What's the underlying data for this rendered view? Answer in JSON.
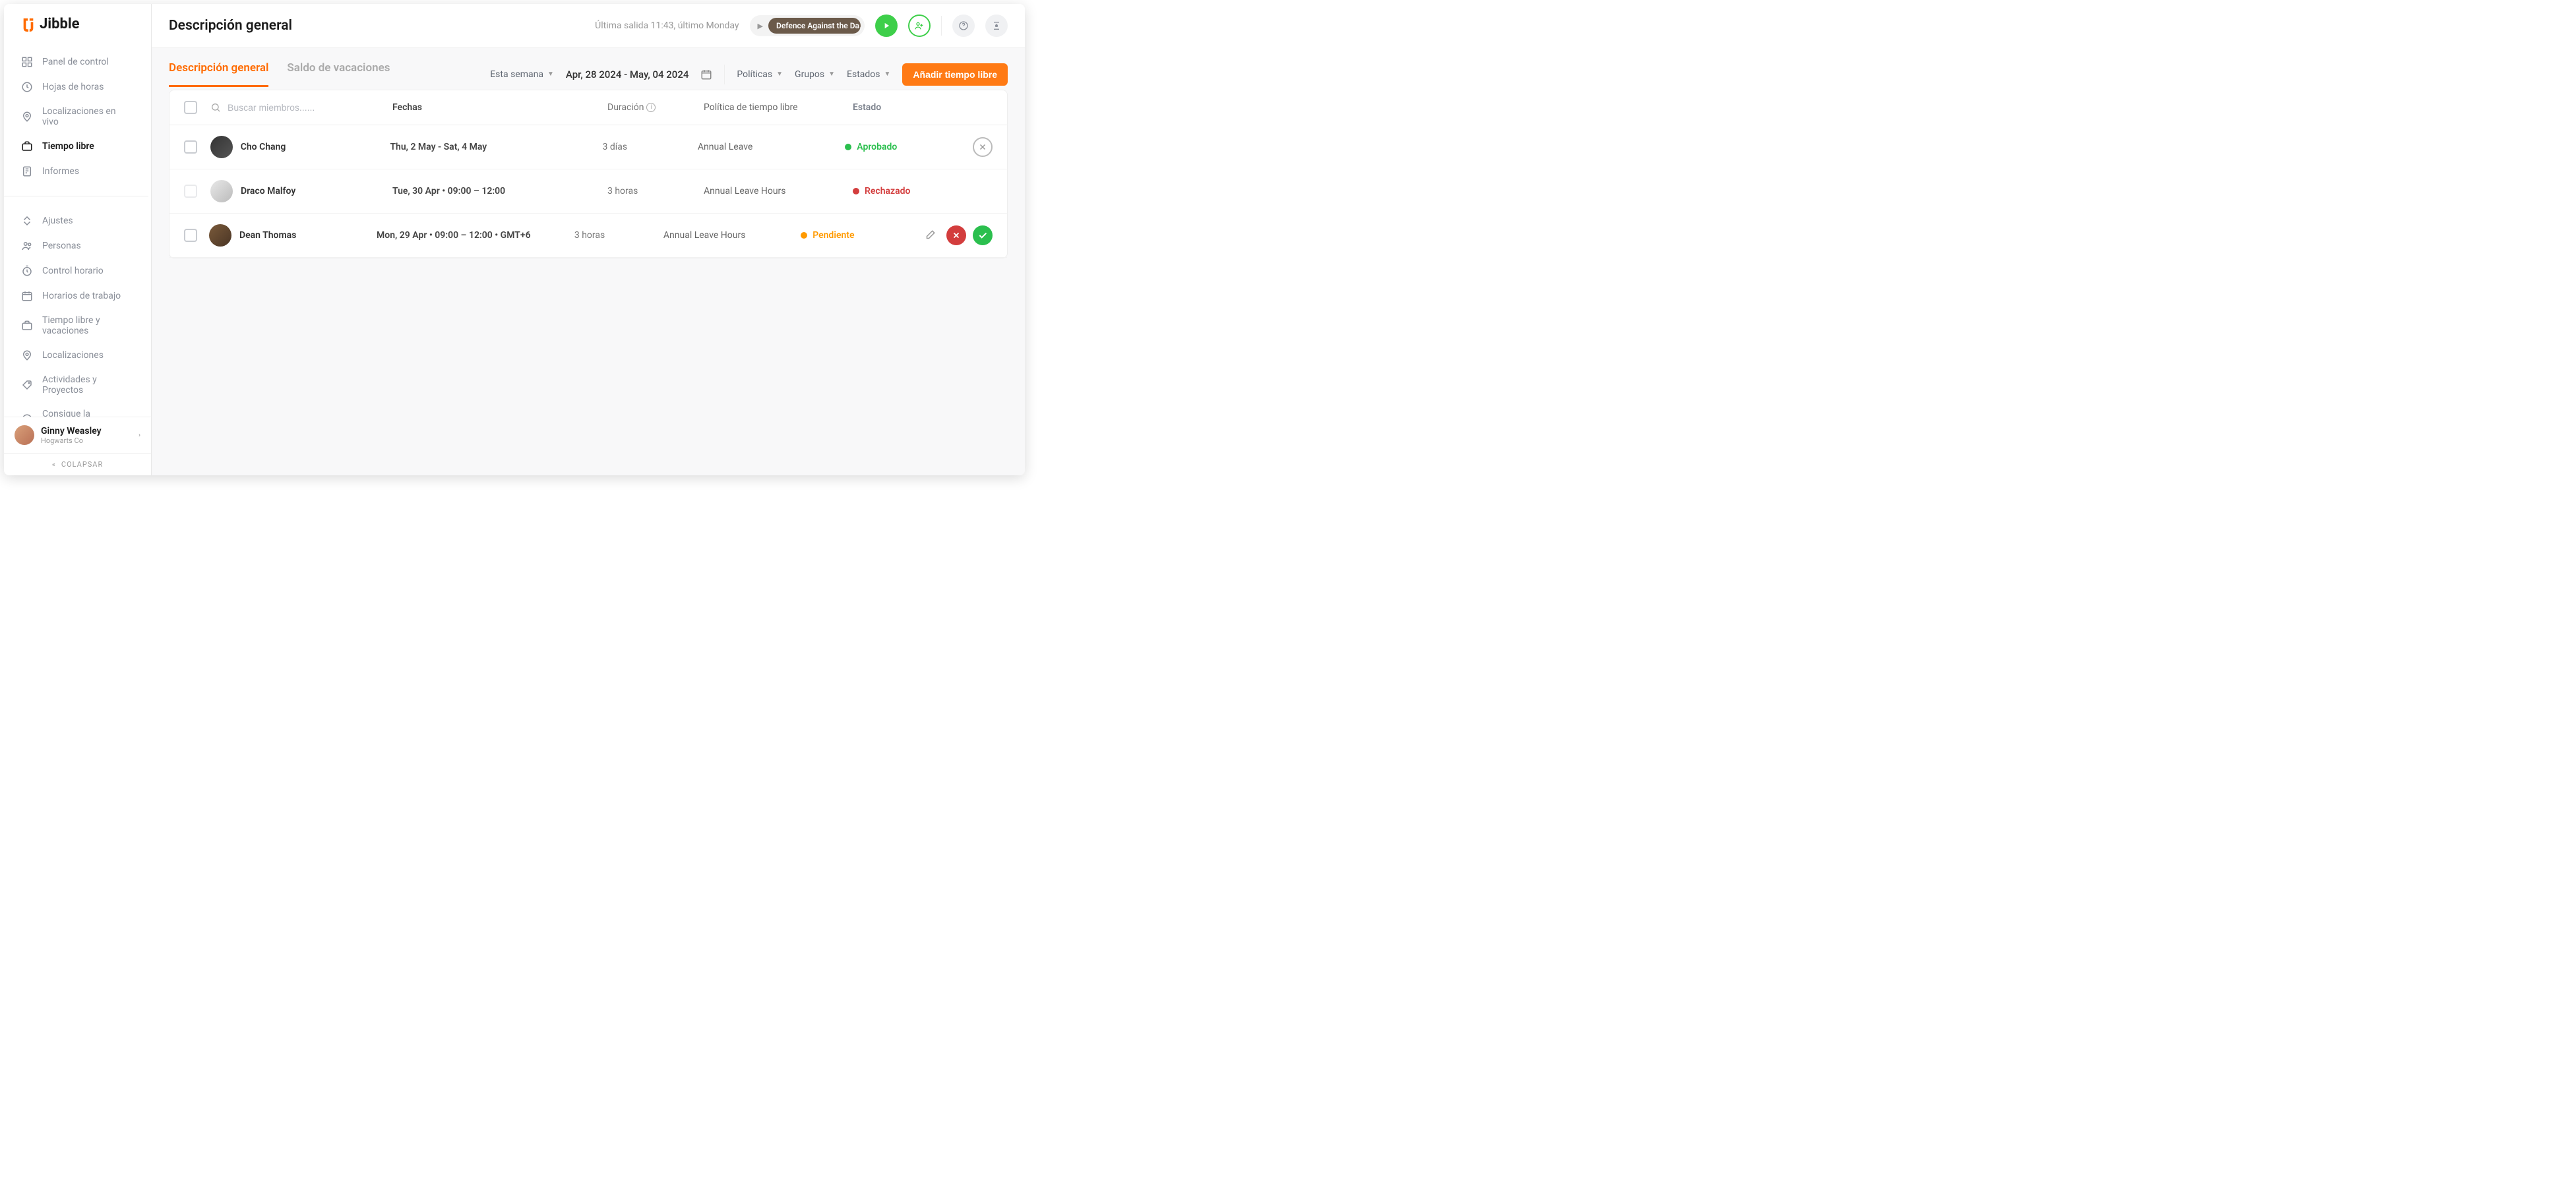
{
  "brand": "Jibble",
  "sidebar": {
    "nav_main": [
      {
        "label": "Panel de control",
        "icon": "dashboard-icon"
      },
      {
        "label": "Hojas de horas",
        "icon": "clock-icon"
      },
      {
        "label": "Localizaciones en vivo",
        "icon": "location-icon"
      },
      {
        "label": "Tiempo libre",
        "icon": "briefcase-icon",
        "active": true
      },
      {
        "label": "Informes",
        "icon": "report-icon"
      }
    ],
    "nav_settings": [
      {
        "label": "Ajustes",
        "icon": "settings-icon"
      },
      {
        "label": "Personas",
        "icon": "people-icon"
      },
      {
        "label": "Control horario",
        "icon": "time-tracking-icon"
      },
      {
        "label": "Horarios de trabajo",
        "icon": "schedule-icon"
      },
      {
        "label": "Tiempo libre y vacaciones",
        "icon": "vacation-icon"
      },
      {
        "label": "Localizaciones",
        "icon": "locations-icon"
      },
      {
        "label": "Actividades y Proyectos",
        "icon": "tag-icon"
      },
      {
        "label": "Consigue la aplicación",
        "icon": "download-icon"
      }
    ],
    "user": {
      "name": "Ginny Weasley",
      "org": "Hogwarts Co"
    },
    "collapse": "COLAPSAR"
  },
  "header": {
    "title": "Descripción general",
    "last_checkout": "Última salida 11:43, último Monday",
    "tracker_label": "Defence Against the Da..."
  },
  "toolbar": {
    "tabs": [
      {
        "label": "Descripción general",
        "active": true
      },
      {
        "label": "Saldo de vacaciones",
        "active": false
      }
    ],
    "period": "Esta semana",
    "date_range": "Apr, 28 2024 - May, 04 2024",
    "filters": {
      "policies": "Políticas",
      "groups": "Grupos",
      "states": "Estados"
    },
    "add_button": "Añadir tiempo libre"
  },
  "table": {
    "search_placeholder": "Buscar miembros......",
    "headers": {
      "dates": "Fechas",
      "duration": "Duración",
      "policy": "Política de tiempo libre",
      "status": "Estado"
    },
    "rows": [
      {
        "member": "Cho Chang",
        "dates": "Thu, 2 May - Sat, 4 May",
        "duration": "3 días",
        "policy": "Annual Leave",
        "status": "Aprobado",
        "status_class": "approved",
        "actions": [
          "delete"
        ]
      },
      {
        "member": "Draco Malfoy",
        "dates": "Tue, 30 Apr • 09:00 – 12:00",
        "duration": "3 horas",
        "policy": "Annual Leave Hours",
        "status": "Rechazado",
        "status_class": "rejected",
        "checkbox_disabled": true,
        "actions": []
      },
      {
        "member": "Dean Thomas",
        "dates": "Mon, 29 Apr • 09:00 – 12:00 • GMT+6",
        "duration": "3 horas",
        "policy": "Annual Leave Hours",
        "status": "Pendiente",
        "status_class": "pending",
        "actions": [
          "edit",
          "reject",
          "approve"
        ]
      }
    ]
  }
}
